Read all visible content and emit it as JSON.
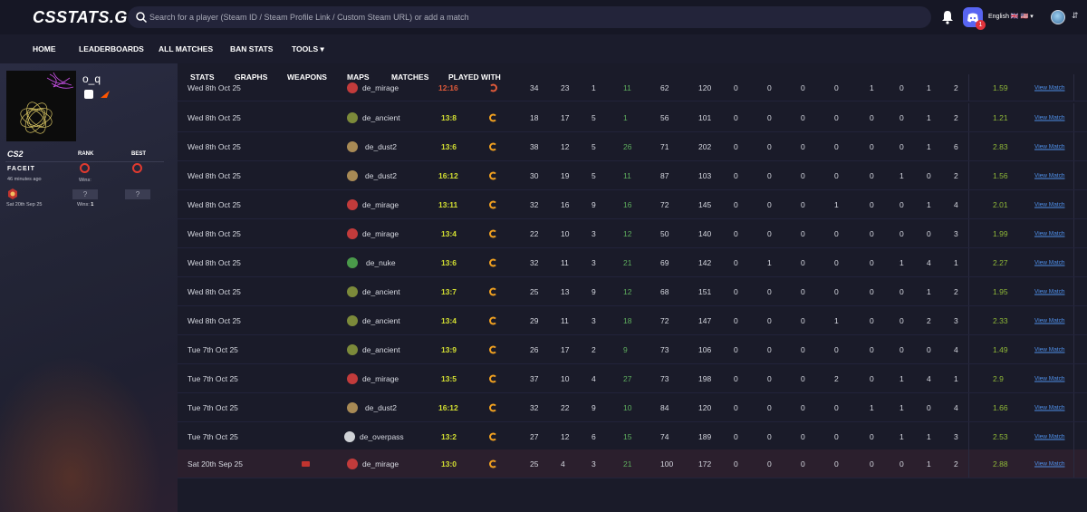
{
  "logo": "CSSTATS.GG",
  "search": {
    "placeholder": "Search for a player (Steam ID / Steam Profile Link / Custom Steam URL) or add a match"
  },
  "header": {
    "notification_count": "1",
    "language": "English 🇬🇧 🇺🇸 ▾",
    "user_caret": "⇵"
  },
  "nav": {
    "items": [
      "HOME",
      "LEADERBOARDS",
      "ALL MATCHES",
      "BAN STATS",
      "TOOLS ▾"
    ]
  },
  "profile": {
    "name": "o_q",
    "cs2_label": "CS2",
    "rank_label": "RANK",
    "best_label": "BEST",
    "faceit_label": "FACEIT",
    "faceit_time": "46 minutes ago",
    "faceit_wins": "Wins:",
    "mm_rank": "?",
    "mm_best": "?",
    "mm_date": "Sat 20th Sep 25",
    "mm_wins_label": "Wins:",
    "mm_wins_value": "1"
  },
  "subtabs": [
    "STATS",
    "GRAPHS",
    "WEAPONS",
    "MAPS",
    "MATCHES",
    "PLAYED WITH"
  ],
  "matches": {
    "view_label": "View Match",
    "rows": [
      {
        "date": "Wed 8th Oct 25",
        "map": "de_mirage",
        "score": "12:16",
        "k": "34",
        "d": "23",
        "a": "1",
        "hs": "11",
        "adr": "62",
        "dmg": "120",
        "s1": "0",
        "s2": "0",
        "s3": "0",
        "s4": "0",
        "s5": "1",
        "s6": "0",
        "s7": "1",
        "s8": "2",
        "rating": "1.59",
        "result": "loss",
        "icon": "#c23b3b"
      },
      {
        "date": "Wed 8th Oct 25",
        "map": "de_ancient",
        "score": "13:8",
        "k": "18",
        "d": "17",
        "a": "5",
        "hs": "1",
        "adr": "56",
        "dmg": "101",
        "s1": "0",
        "s2": "0",
        "s3": "0",
        "s4": "0",
        "s5": "0",
        "s6": "0",
        "s7": "1",
        "s8": "2",
        "rating": "1.21",
        "result": "win",
        "icon": "#7c8a3a"
      },
      {
        "date": "Wed 8th Oct 25",
        "map": "de_dust2",
        "score": "13:6",
        "k": "38",
        "d": "12",
        "a": "5",
        "hs": "26",
        "adr": "71",
        "dmg": "202",
        "s1": "0",
        "s2": "0",
        "s3": "0",
        "s4": "0",
        "s5": "0",
        "s6": "0",
        "s7": "1",
        "s8": "6",
        "rating": "2.83",
        "result": "win",
        "icon": "#a88a55"
      },
      {
        "date": "Wed 8th Oct 25",
        "map": "de_dust2",
        "score": "16:12",
        "k": "30",
        "d": "19",
        "a": "5",
        "hs": "11",
        "adr": "87",
        "dmg": "103",
        "s1": "0",
        "s2": "0",
        "s3": "0",
        "s4": "0",
        "s5": "0",
        "s6": "1",
        "s7": "0",
        "s8": "2",
        "rating": "1.56",
        "result": "win",
        "icon": "#a88a55"
      },
      {
        "date": "Wed 8th Oct 25",
        "map": "de_mirage",
        "score": "13:11",
        "k": "32",
        "d": "16",
        "a": "9",
        "hs": "16",
        "adr": "72",
        "dmg": "145",
        "s1": "0",
        "s2": "0",
        "s3": "0",
        "s4": "1",
        "s5": "0",
        "s6": "0",
        "s7": "1",
        "s8": "4",
        "rating": "2.01",
        "result": "win",
        "icon": "#c23b3b"
      },
      {
        "date": "Wed 8th Oct 25",
        "map": "de_mirage",
        "score": "13:4",
        "k": "22",
        "d": "10",
        "a": "3",
        "hs": "12",
        "adr": "50",
        "dmg": "140",
        "s1": "0",
        "s2": "0",
        "s3": "0",
        "s4": "0",
        "s5": "0",
        "s6": "0",
        "s7": "0",
        "s8": "3",
        "rating": "1.99",
        "result": "win",
        "icon": "#c23b3b"
      },
      {
        "date": "Wed 8th Oct 25",
        "map": "de_nuke",
        "score": "13:6",
        "k": "32",
        "d": "11",
        "a": "3",
        "hs": "21",
        "adr": "69",
        "dmg": "142",
        "s1": "0",
        "s2": "1",
        "s3": "0",
        "s4": "0",
        "s5": "0",
        "s6": "1",
        "s7": "4",
        "s8": "1",
        "rating": "2.27",
        "result": "win",
        "icon": "#4a9a4a"
      },
      {
        "date": "Wed 8th Oct 25",
        "map": "de_ancient",
        "score": "13:7",
        "k": "25",
        "d": "13",
        "a": "9",
        "hs": "12",
        "adr": "68",
        "dmg": "151",
        "s1": "0",
        "s2": "0",
        "s3": "0",
        "s4": "0",
        "s5": "0",
        "s6": "0",
        "s7": "1",
        "s8": "2",
        "rating": "1.95",
        "result": "win",
        "icon": "#7c8a3a"
      },
      {
        "date": "Wed 8th Oct 25",
        "map": "de_ancient",
        "score": "13:4",
        "k": "29",
        "d": "11",
        "a": "3",
        "hs": "18",
        "adr": "72",
        "dmg": "147",
        "s1": "0",
        "s2": "0",
        "s3": "0",
        "s4": "1",
        "s5": "0",
        "s6": "0",
        "s7": "2",
        "s8": "3",
        "rating": "2.33",
        "result": "win",
        "icon": "#7c8a3a"
      },
      {
        "date": "Tue 7th Oct 25",
        "map": "de_ancient",
        "score": "13:9",
        "k": "26",
        "d": "17",
        "a": "2",
        "hs": "9",
        "adr": "73",
        "dmg": "106",
        "s1": "0",
        "s2": "0",
        "s3": "0",
        "s4": "0",
        "s5": "0",
        "s6": "0",
        "s7": "0",
        "s8": "4",
        "rating": "1.49",
        "result": "win",
        "icon": "#7c8a3a"
      },
      {
        "date": "Tue 7th Oct 25",
        "map": "de_mirage",
        "score": "13:5",
        "k": "37",
        "d": "10",
        "a": "4",
        "hs": "27",
        "adr": "73",
        "dmg": "198",
        "s1": "0",
        "s2": "0",
        "s3": "0",
        "s4": "2",
        "s5": "0",
        "s6": "1",
        "s7": "4",
        "s8": "1",
        "rating": "2.9",
        "result": "win",
        "icon": "#c23b3b"
      },
      {
        "date": "Tue 7th Oct 25",
        "map": "de_dust2",
        "score": "16:12",
        "k": "32",
        "d": "22",
        "a": "9",
        "hs": "10",
        "adr": "84",
        "dmg": "120",
        "s1": "0",
        "s2": "0",
        "s3": "0",
        "s4": "0",
        "s5": "1",
        "s6": "1",
        "s7": "0",
        "s8": "4",
        "rating": "1.66",
        "result": "win",
        "icon": "#a88a55"
      },
      {
        "date": "Tue 7th Oct 25",
        "map": "de_overpass",
        "score": "13:2",
        "k": "27",
        "d": "12",
        "a": "6",
        "hs": "15",
        "adr": "74",
        "dmg": "189",
        "s1": "0",
        "s2": "0",
        "s3": "0",
        "s4": "0",
        "s5": "0",
        "s6": "1",
        "s7": "1",
        "s8": "3",
        "rating": "2.53",
        "result": "win",
        "icon": "#cfd2d6"
      },
      {
        "date": "Sat 20th Sep 25",
        "map": "de_mirage",
        "score": "13:0",
        "k": "25",
        "d": "4",
        "a": "3",
        "hs": "21",
        "adr": "100",
        "dmg": "172",
        "s1": "0",
        "s2": "0",
        "s3": "0",
        "s4": "0",
        "s5": "0",
        "s6": "0",
        "s7": "1",
        "s8": "2",
        "rating": "2.88",
        "result": "win",
        "icon": "#c23b3b",
        "highlight": true
      }
    ]
  },
  "colors": {
    "win": "#d4e032",
    "loss": "#e05a3a",
    "link": "#4f8fe8",
    "rating": "#8fb838",
    "hs": "#5eae5e"
  }
}
